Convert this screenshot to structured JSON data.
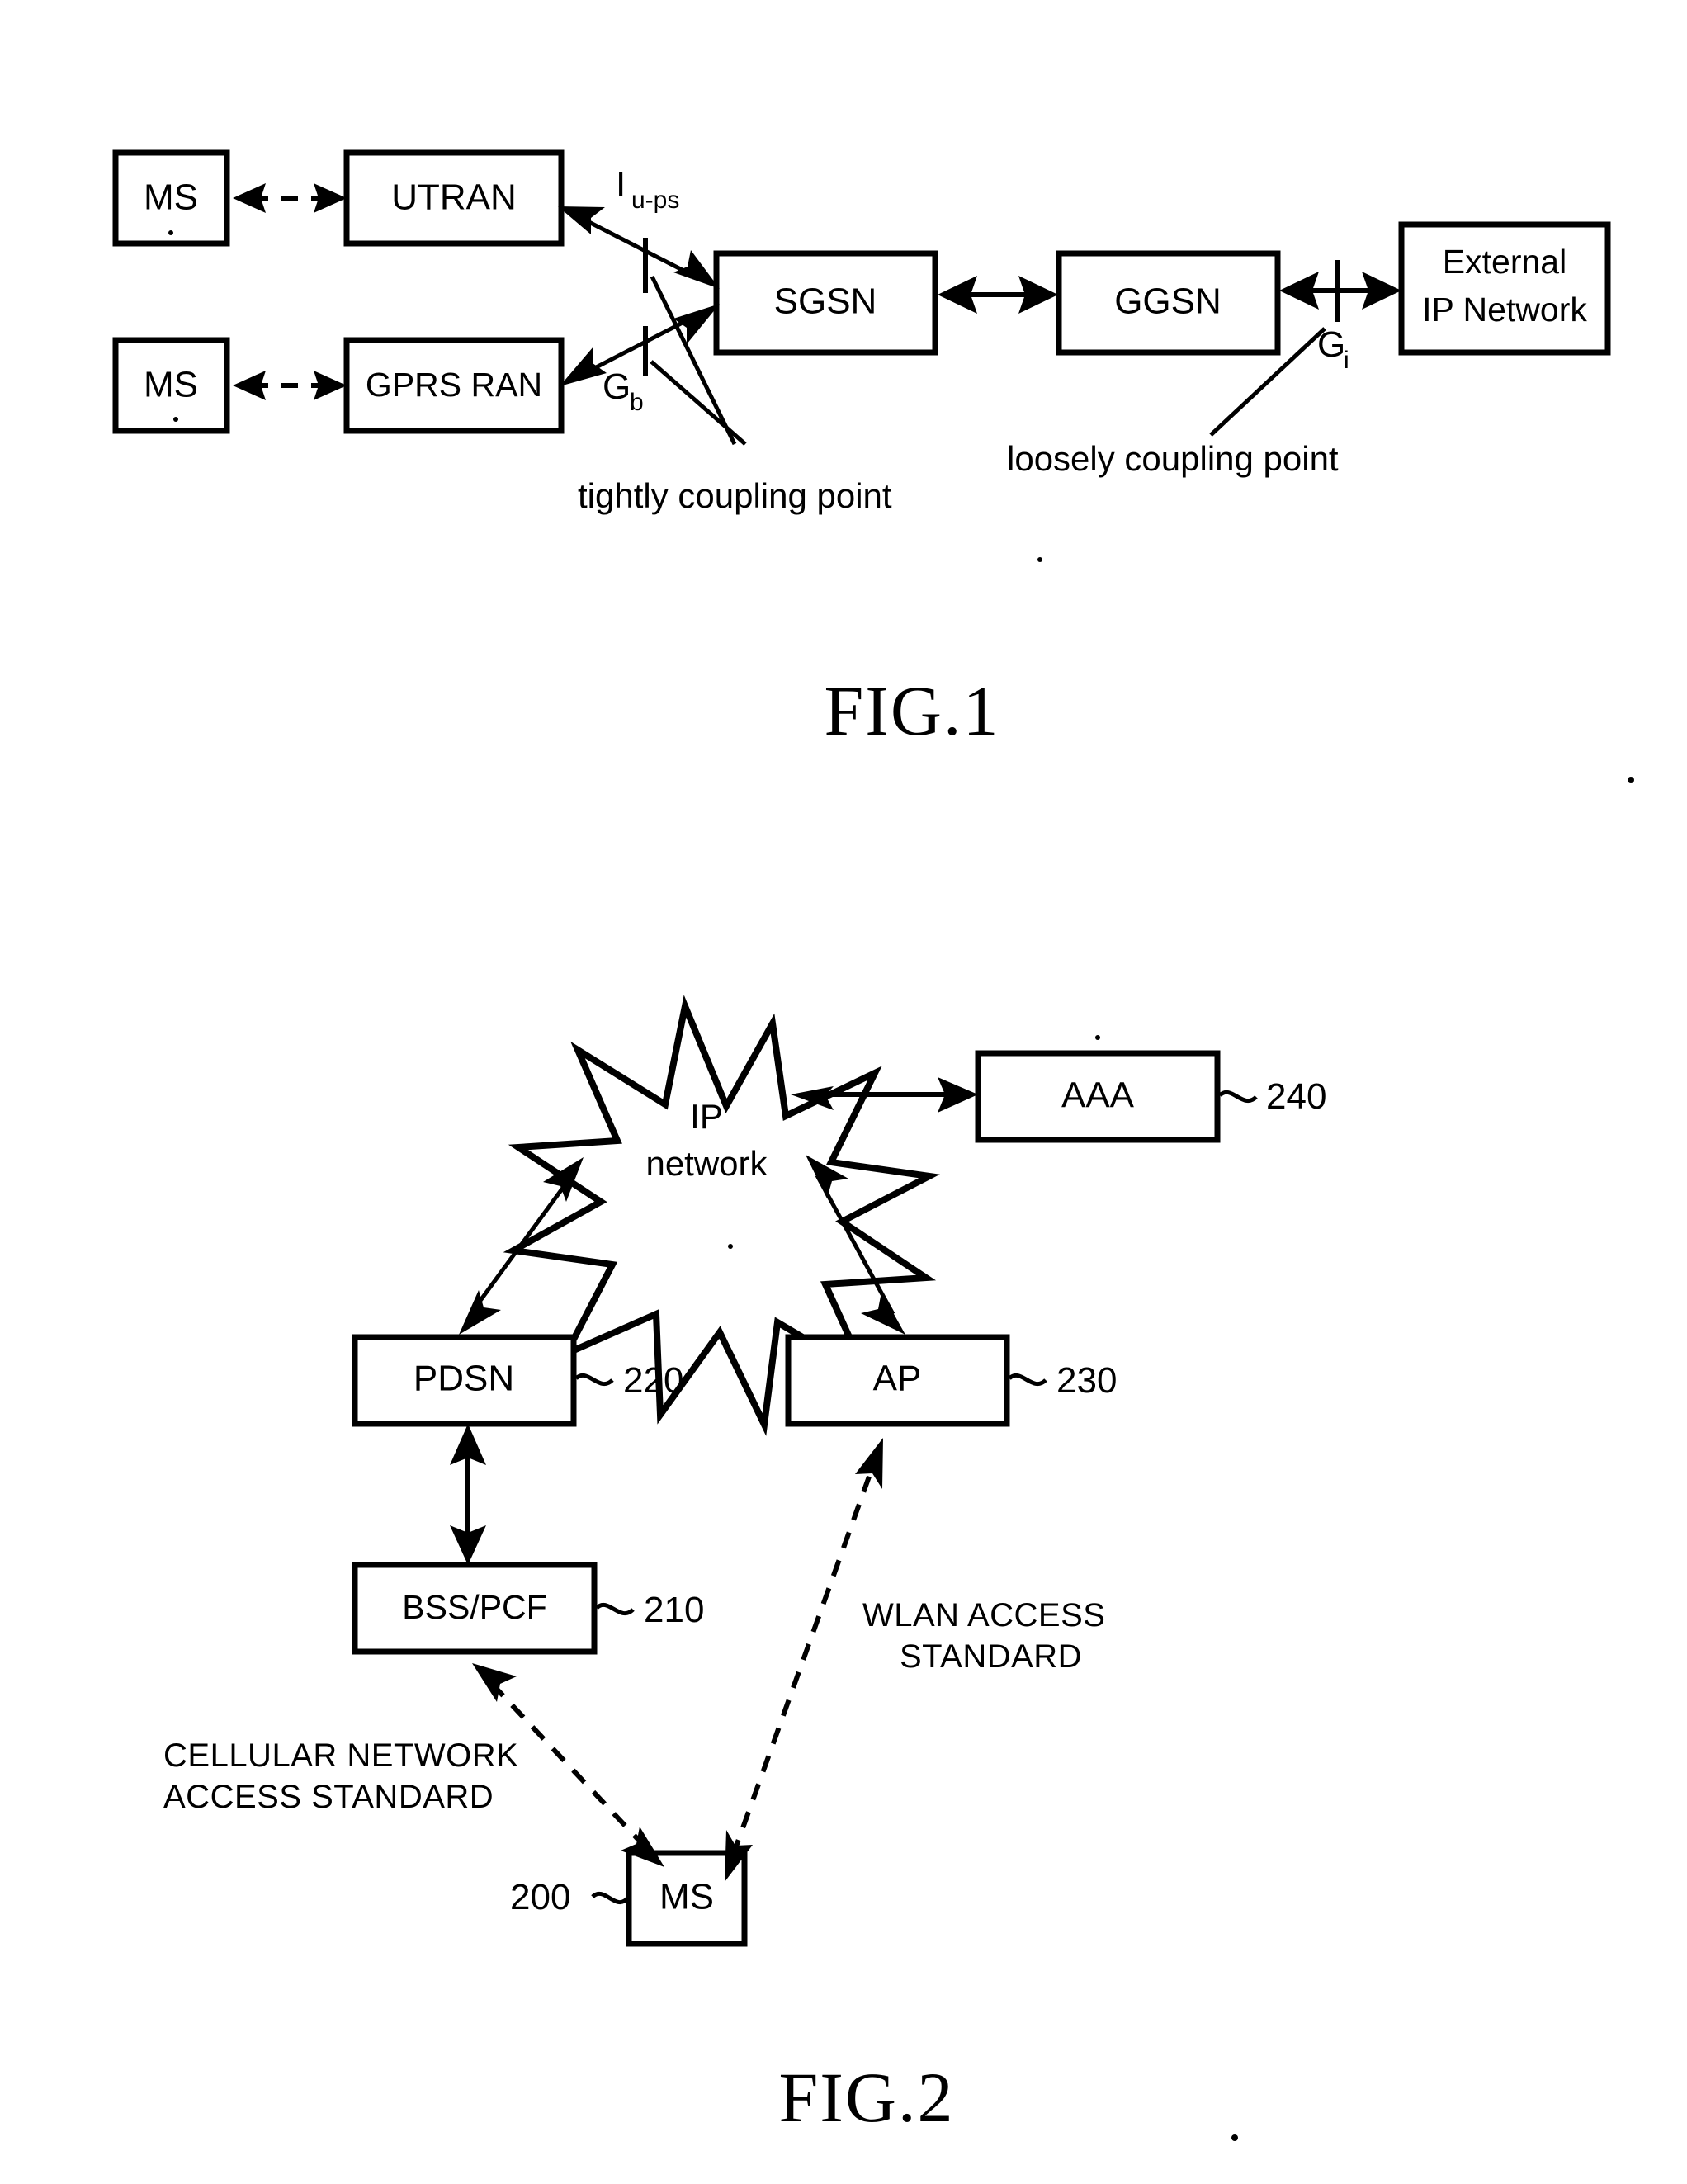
{
  "page": {
    "background": "#ffffff",
    "ink": "#000000"
  },
  "figures": [
    {
      "id": "fig1",
      "caption": "FIG.1",
      "nodes": [
        {
          "key": "ms_top",
          "label": "MS"
        },
        {
          "key": "utran",
          "label": "UTRAN"
        },
        {
          "key": "ms_bottom",
          "label": "MS"
        },
        {
          "key": "gprs_ran",
          "label": "GPRS RAN"
        },
        {
          "key": "sgsn",
          "label": "SGSN"
        },
        {
          "key": "ggsn",
          "label": "GGSN"
        },
        {
          "key": "ext_ip",
          "label_line1": "External",
          "label_line2": "IP Network"
        }
      ],
      "interfaces": [
        {
          "key": "iu_ps",
          "base": "I",
          "sub": "u-ps"
        },
        {
          "key": "gb",
          "base": "G",
          "sub": "b"
        },
        {
          "key": "gi",
          "base": "G",
          "sub": "i"
        }
      ],
      "annotations": [
        {
          "key": "tightly",
          "text": "tightly coupling point"
        },
        {
          "key": "loosely",
          "text": "loosely coupling point"
        }
      ]
    },
    {
      "id": "fig2",
      "caption": "FIG.2",
      "nodes": [
        {
          "key": "ip_network",
          "label_line1": "IP",
          "label_line2": "network",
          "ref": ""
        },
        {
          "key": "aaa",
          "label": "AAA",
          "ref": "240"
        },
        {
          "key": "pdsn",
          "label": "PDSN",
          "ref": "220"
        },
        {
          "key": "ap",
          "label": "AP",
          "ref": "230"
        },
        {
          "key": "bss_pcf",
          "label": "BSS/PCF",
          "ref": "210"
        },
        {
          "key": "ms",
          "label": "MS",
          "ref": "200"
        }
      ],
      "annotations": [
        {
          "key": "wlan",
          "line1": "WLAN ACCESS",
          "line2": "STANDARD"
        },
        {
          "key": "cellular",
          "line1": "CELLULAR NETWORK",
          "line2": "ACCESS STANDARD"
        }
      ]
    }
  ]
}
